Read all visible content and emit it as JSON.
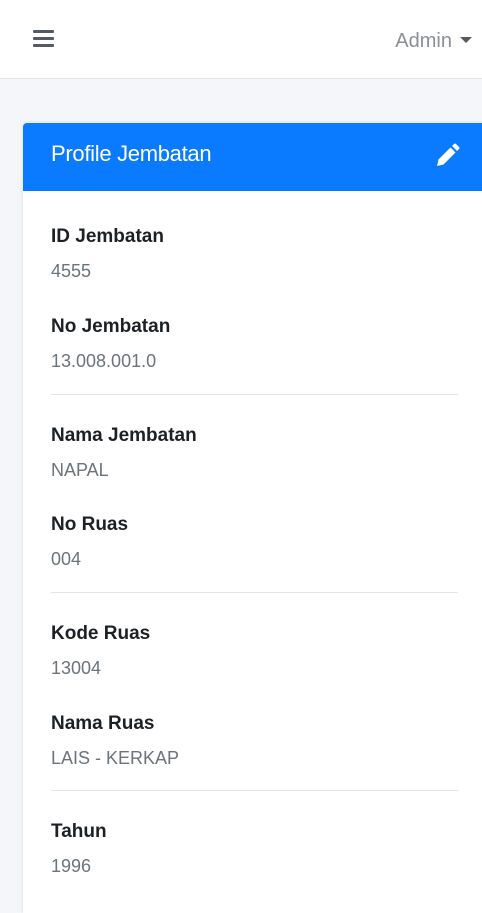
{
  "header": {
    "user_label": "Admin"
  },
  "card": {
    "title": "Profile Jembatan",
    "fields": [
      {
        "label": "ID Jembatan",
        "value": "4555"
      },
      {
        "label": "No Jembatan",
        "value": "13.008.001.0"
      },
      {
        "label": "Nama Jembatan",
        "value": "NAPAL"
      },
      {
        "label": "No Ruas",
        "value": "004"
      },
      {
        "label": "Kode Ruas",
        "value": "13004"
      },
      {
        "label": "Nama Ruas",
        "value": "LAIS - KERKAP"
      },
      {
        "label": "Tahun",
        "value": "1996"
      }
    ]
  },
  "colors": {
    "header_accent": "#0a7bff",
    "page_background": "#f4f6f9"
  },
  "icons": {
    "menu": "hamburger-icon",
    "edit": "pencil-icon",
    "dropdown": "caret-down-icon"
  }
}
